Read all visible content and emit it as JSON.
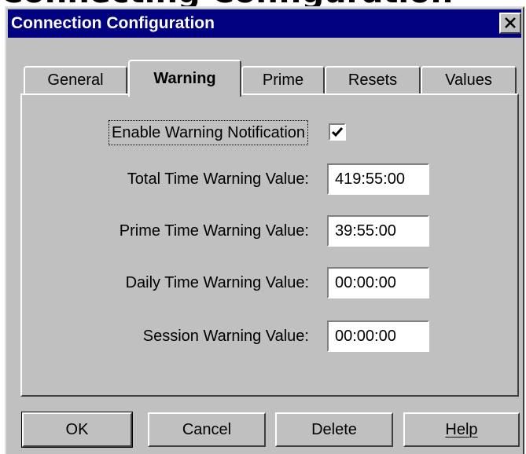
{
  "window": {
    "title": "Connection Configuration",
    "clipped_heading": "Connecting Configuration"
  },
  "tabs": [
    {
      "label": "General",
      "active": false
    },
    {
      "label": "Warning",
      "active": true
    },
    {
      "label": "Prime",
      "active": false
    },
    {
      "label": "Resets",
      "active": false
    },
    {
      "label": "Values",
      "active": false
    }
  ],
  "warning": {
    "enable_label": "Enable Warning Notification",
    "enable_checked": true,
    "fields": [
      {
        "label": "Total Time Warning Value:",
        "value": "419:55:00"
      },
      {
        "label": "Prime Time Warning Value:",
        "value": "39:55:00"
      },
      {
        "label": "Daily Time Warning Value:",
        "value": "00:00:00"
      },
      {
        "label": "Session Warning Value:",
        "value": "00:00:00"
      }
    ]
  },
  "buttons": {
    "ok": "OK",
    "cancel": "Cancel",
    "delete": "Delete",
    "help": "Help"
  },
  "colors": {
    "titlebar": "#000080",
    "face": "#c0c0c0"
  },
  "icons": {
    "close": "close-icon",
    "check": "checkmark-icon"
  }
}
